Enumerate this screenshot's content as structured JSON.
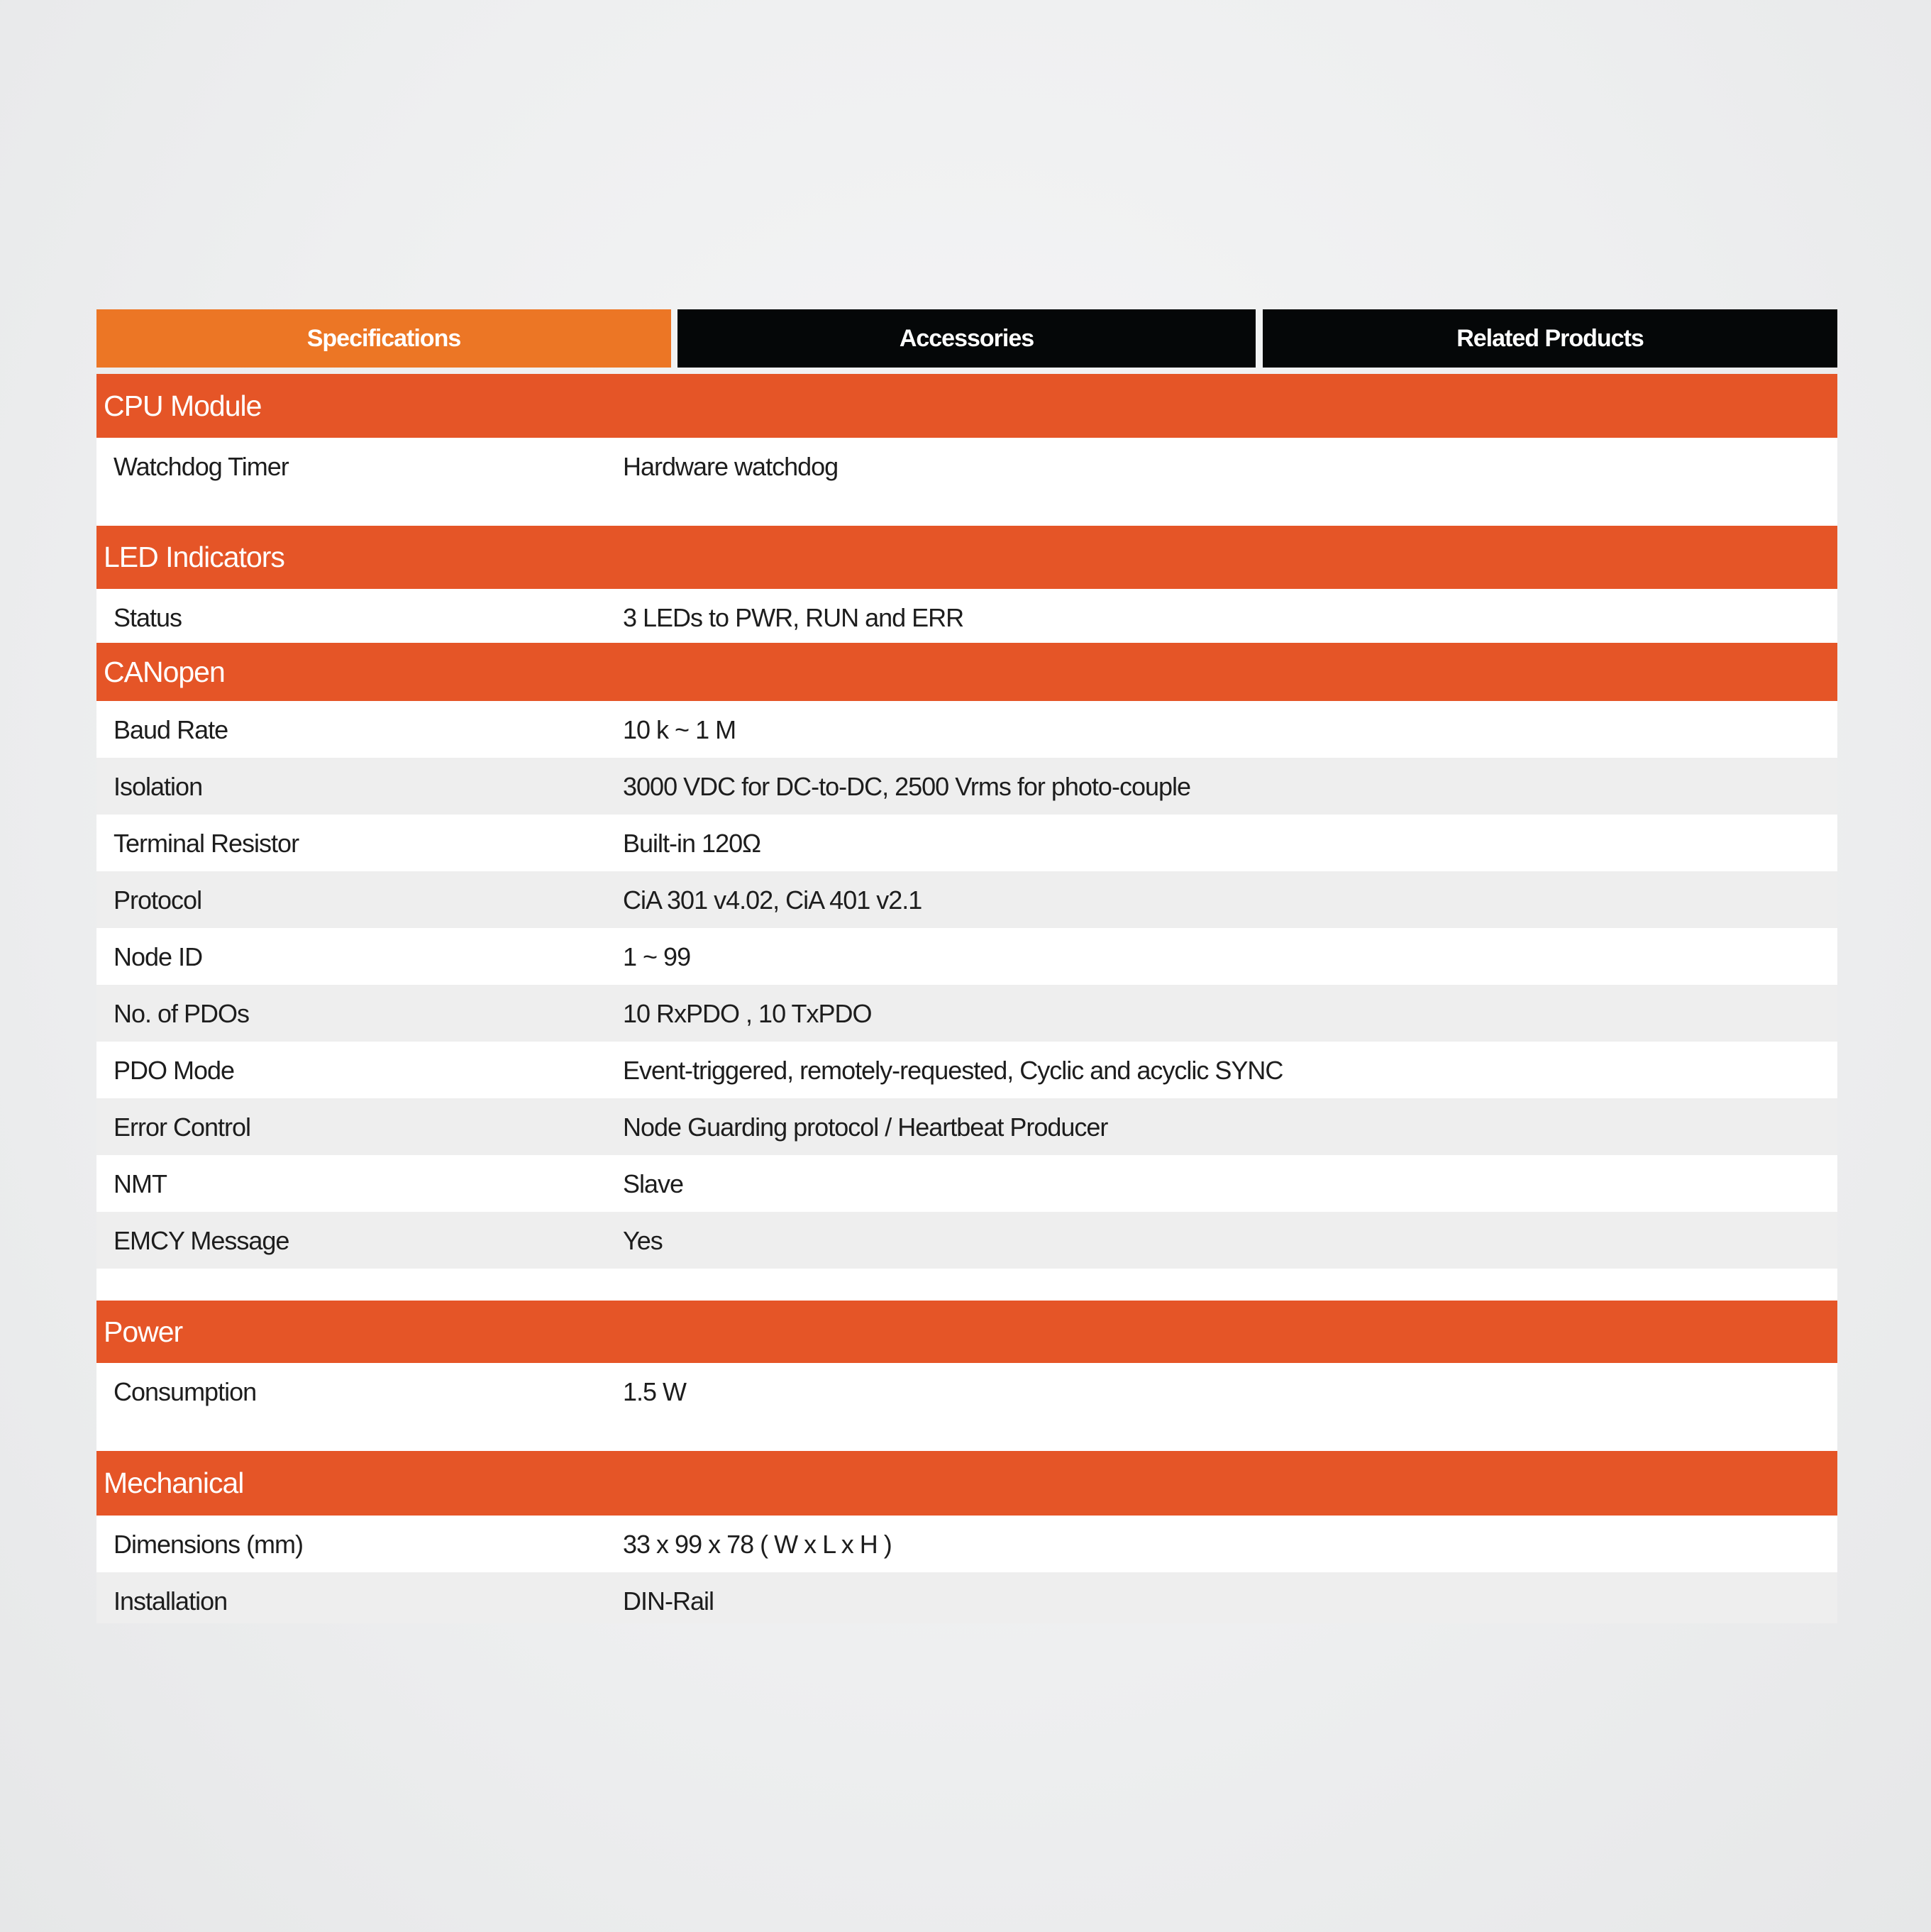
{
  "tabs": [
    {
      "label": "Specifications",
      "active": true
    },
    {
      "label": "Accessories",
      "active": false
    },
    {
      "label": "Related Products",
      "active": false
    }
  ],
  "colors": {
    "active_tab": "#ec7625",
    "inactive_tab": "#050708",
    "section_header": "#e55527",
    "row_alt": "#eeeeee"
  },
  "sections": [
    {
      "title": "CPU Module",
      "rows": [
        {
          "label": "Watchdog Timer",
          "value": "Hardware watchdog"
        }
      ]
    },
    {
      "title": "LED Indicators",
      "rows": [
        {
          "label": "Status",
          "value": "3 LEDs to PWR, RUN and ERR"
        }
      ]
    },
    {
      "title": "CANopen",
      "rows": [
        {
          "label": "Baud Rate",
          "value": "10 k ~ 1 M"
        },
        {
          "label": "Isolation",
          "value": "3000 VDC for DC-to-DC, 2500 Vrms for photo-couple"
        },
        {
          "label": "Terminal Resistor",
          "value": "Built-in 120Ω"
        },
        {
          "label": "Protocol",
          "value": "CiA 301 v4.02, CiA 401 v2.1"
        },
        {
          "label": "Node ID",
          "value": "1 ~ 99"
        },
        {
          "label": "No. of PDOs",
          "value": "10 RxPDO , 10 TxPDO"
        },
        {
          "label": "PDO Mode",
          "value": "Event-triggered, remotely-requested, Cyclic and acyclic SYNC"
        },
        {
          "label": "Error Control",
          "value": "Node Guarding protocol / Heartbeat Producer"
        },
        {
          "label": "NMT",
          "value": "Slave"
        },
        {
          "label": "EMCY Message",
          "value": "Yes"
        }
      ]
    },
    {
      "title": "Power",
      "rows": [
        {
          "label": "Consumption",
          "value": "1.5 W"
        }
      ]
    },
    {
      "title": "Mechanical",
      "rows": [
        {
          "label": "Dimensions (mm)",
          "value": "33 x 99 x 78 ( W x L x H )"
        },
        {
          "label": "Installation",
          "value": "DIN-Rail"
        }
      ]
    }
  ]
}
